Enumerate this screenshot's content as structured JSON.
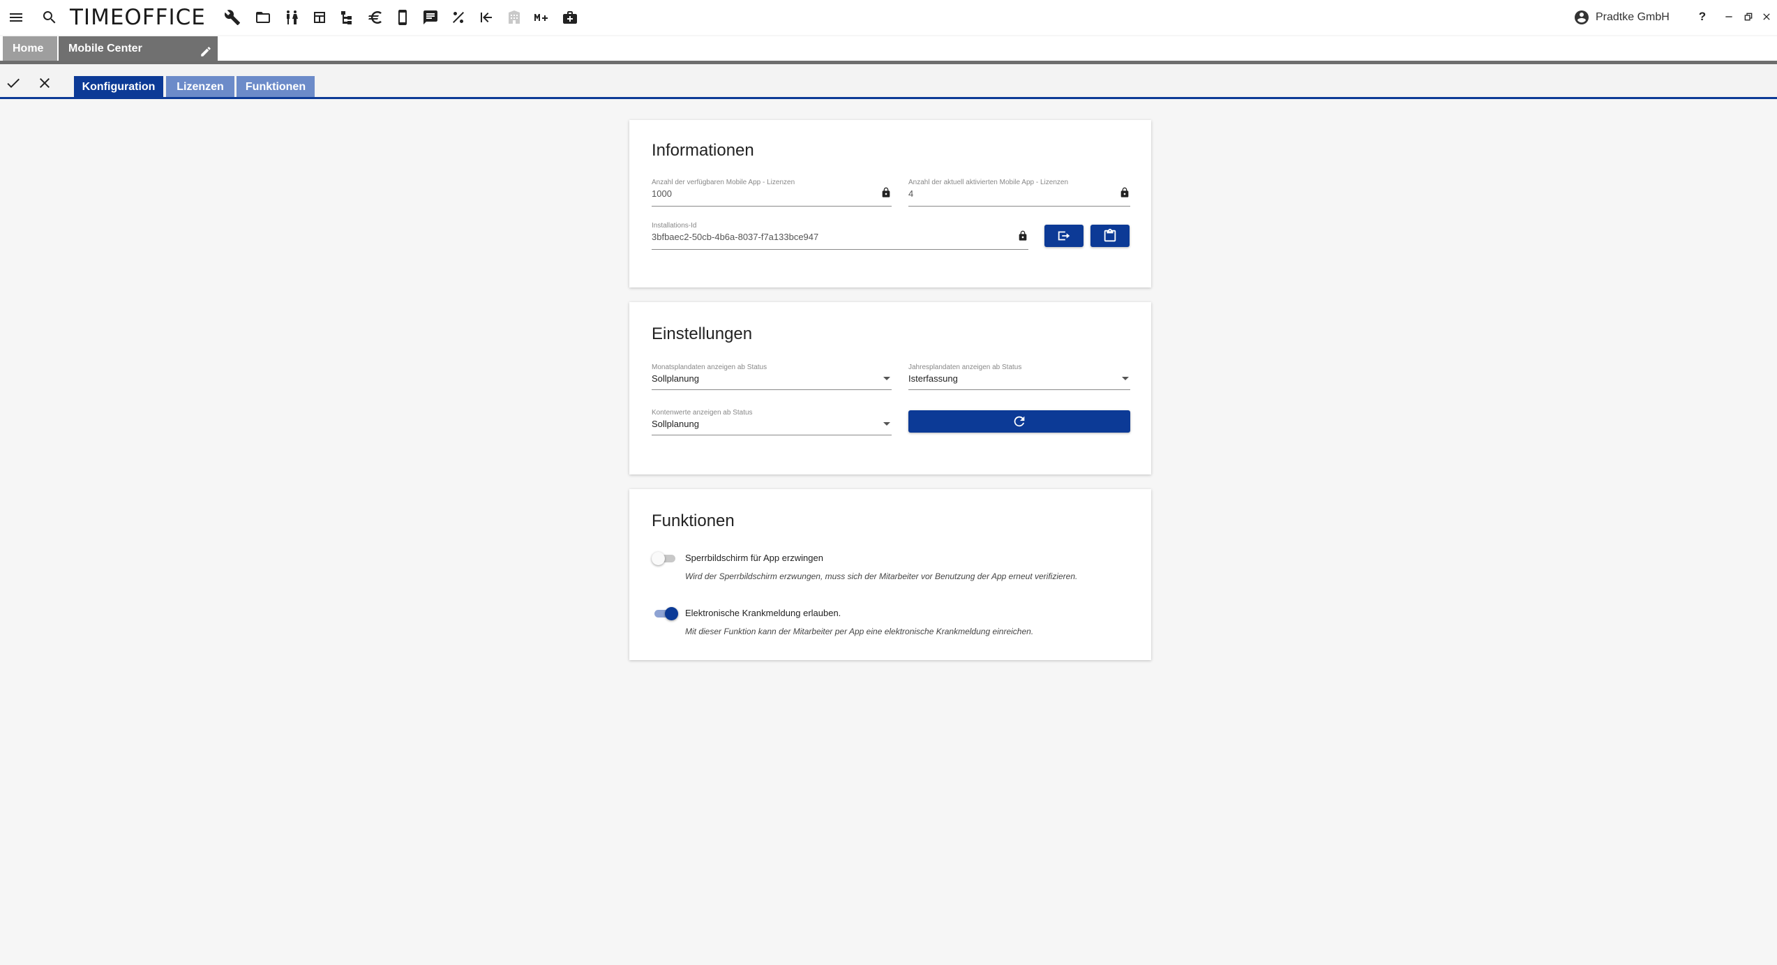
{
  "app": {
    "logo_text": "TIMEOFFICE",
    "user_name": "Pradtke GmbH",
    "help_label": "?",
    "toolbar_icons": [
      "menu-icon",
      "search-icon",
      "wrench-icon",
      "folder-open-icon",
      "people-icon",
      "calendar-view-icon",
      "hierarchy-icon",
      "euro-icon",
      "smartphone-icon",
      "comment-icon",
      "percent-icon",
      "first-page-icon",
      "building-icon",
      "memory-plus-icon",
      "medical-bag-icon"
    ]
  },
  "breadcrumb": {
    "home": "Home",
    "active": "Mobile Center"
  },
  "tabs": [
    "Konfiguration",
    "Lizenzen",
    "Funktionen"
  ],
  "active_tab": "Konfiguration",
  "informationen": {
    "title": "Informationen",
    "available_label": "Anzahl der verfügbaren Mobile App - Lizenzen",
    "available_value": "1000",
    "active_label": "Anzahl der aktuell aktivierten Mobile App - Lizenzen",
    "active_value": "4",
    "installation_label": "Installations-Id",
    "installation_value": "3bfbaec2-50cb-4b6a-8037-f7a133bce947"
  },
  "einstellungen": {
    "title": "Einstellungen",
    "monat_label": "Monatsplandaten anzeigen ab Status",
    "monat_value": "Sollplanung",
    "jahr_label": "Jahresplandaten anzeigen ab Status",
    "jahr_value": "Isterfassung",
    "konto_label": "Kontenwerte anzeigen ab Status",
    "konto_value": "Sollplanung"
  },
  "funktionen": {
    "title": "Funktionen",
    "items": [
      {
        "title": "Sperrbildschirm für App erzwingen",
        "description": "Wird der Sperrbildschirm erzwungen, muss sich der Mitarbeiter vor Benutzung der App erneut verifizieren.",
        "enabled": false
      },
      {
        "title": "Elektronische Krankmeldung erlauben.",
        "description": "Mit dieser Funktion kann der Mitarbeiter per App eine elektronische Krankmeldung einreichen.",
        "enabled": true
      }
    ]
  },
  "colors": {
    "primary": "#0c3a96",
    "tab_inactive": "#6c8bc9",
    "crumb_active": "#707070",
    "crumb_home": "#9e9e9e"
  }
}
